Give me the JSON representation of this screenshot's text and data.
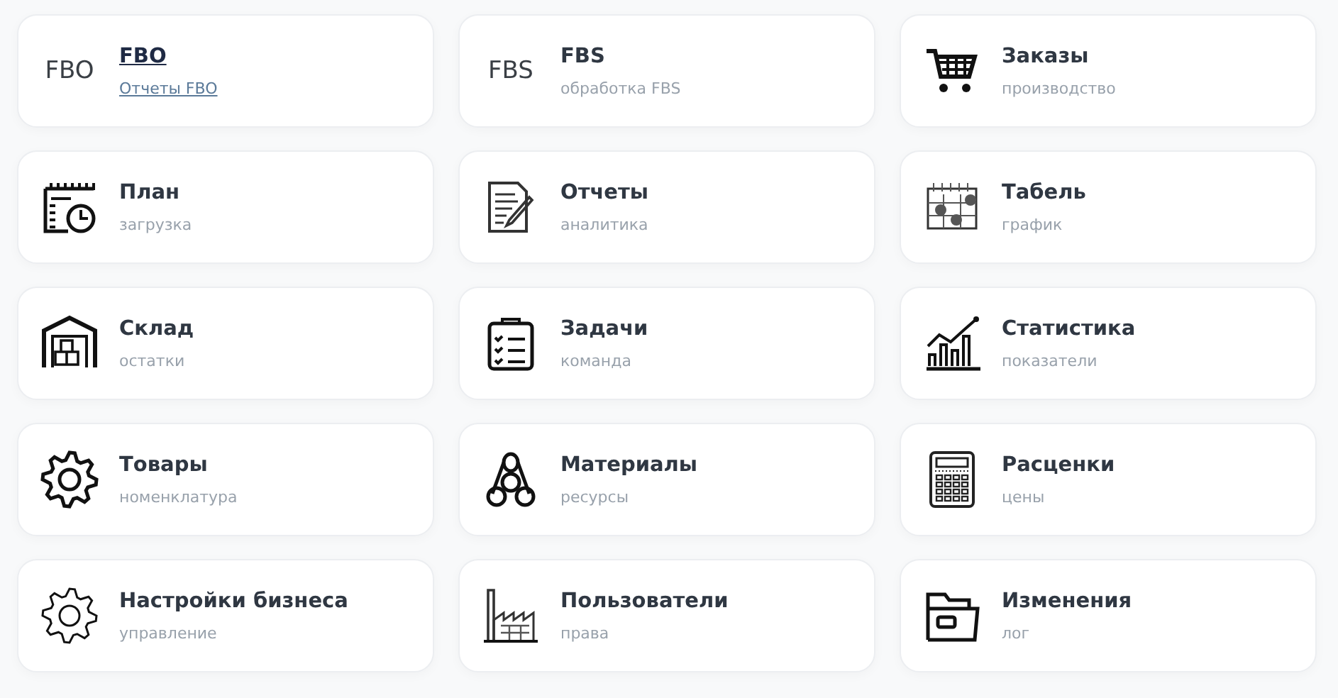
{
  "cards": [
    {
      "title": "FBO",
      "subtitle": "Отчеты FBO",
      "icon": {
        "kind": "text",
        "text": "FBO"
      },
      "selected": true
    },
    {
      "title": "FBS",
      "subtitle": "обработка FBS",
      "icon": {
        "kind": "text",
        "text": "FBS"
      },
      "selected": false
    },
    {
      "title": "Заказы",
      "subtitle": "производство",
      "icon": {
        "kind": "cart"
      },
      "selected": false
    },
    {
      "title": "План",
      "subtitle": "загрузка",
      "icon": {
        "kind": "calendar-clock"
      },
      "selected": false
    },
    {
      "title": "Отчеты",
      "subtitle": "аналитика",
      "icon": {
        "kind": "document-pen"
      },
      "selected": false
    },
    {
      "title": "Табель",
      "subtitle": "график",
      "icon": {
        "kind": "calendar-check"
      },
      "selected": false
    },
    {
      "title": "Склад",
      "subtitle": "остатки",
      "icon": {
        "kind": "warehouse"
      },
      "selected": false
    },
    {
      "title": "Задачи",
      "subtitle": "команда",
      "icon": {
        "kind": "clipboard"
      },
      "selected": false
    },
    {
      "title": "Статистика",
      "subtitle": "показатели",
      "icon": {
        "kind": "chart"
      },
      "selected": false
    },
    {
      "title": "Товары",
      "subtitle": "номенклатура",
      "icon": {
        "kind": "gear"
      },
      "selected": false
    },
    {
      "title": "Материалы",
      "subtitle": "ресурсы",
      "icon": {
        "kind": "pipes"
      },
      "selected": false
    },
    {
      "title": "Расценки",
      "subtitle": "цены",
      "icon": {
        "kind": "calculator"
      },
      "selected": false
    },
    {
      "title": "Настройки бизнеса",
      "subtitle": "управление",
      "icon": {
        "kind": "gear-thin"
      },
      "selected": false
    },
    {
      "title": "Пользователи",
      "subtitle": "права",
      "icon": {
        "kind": "factory"
      },
      "selected": false
    },
    {
      "title": "Изменения",
      "subtitle": "лог",
      "icon": {
        "kind": "folder"
      },
      "selected": false
    }
  ]
}
